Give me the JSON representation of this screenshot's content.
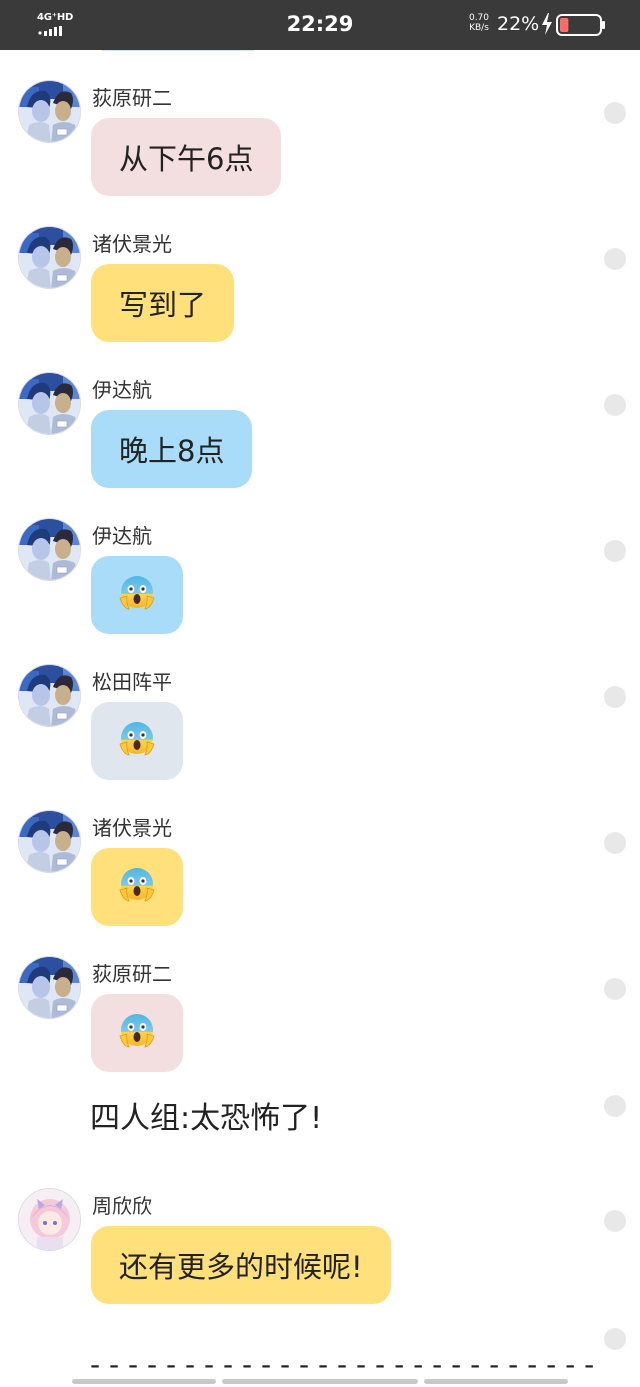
{
  "status_bar": {
    "network": "4G⁺HD",
    "time": "22:29",
    "speed_value": "0.70",
    "speed_unit": "KB/s",
    "battery_percent": "22%",
    "battery_level": 0.22
  },
  "colors": {
    "pink_bubble": "#f3dfe0",
    "yellow_bubble": "#ffe07a",
    "blue_bubble": "#a8dcf9",
    "gray_bubble": "#e0e6ee"
  },
  "messages": [
    {
      "sender": "荻原研二",
      "text": "从下午6点",
      "bubble_color": "pink",
      "avatar": "anime-avatar"
    },
    {
      "sender": "诸伏景光",
      "text": "写到了",
      "bubble_color": "yellow",
      "avatar": "anime-avatar"
    },
    {
      "sender": "伊达航",
      "text": "晚上8点",
      "bubble_color": "blue",
      "avatar": "anime-avatar"
    },
    {
      "sender": "伊达航",
      "text": "😱",
      "bubble_color": "blue",
      "avatar": "anime-avatar"
    },
    {
      "sender": "松田阵平",
      "text": "😱",
      "bubble_color": "gray",
      "avatar": "anime-avatar"
    },
    {
      "sender": "诸伏景光",
      "text": "😱",
      "bubble_color": "yellow",
      "avatar": "anime-avatar"
    },
    {
      "sender": "荻原研二",
      "text": "😱",
      "bubble_color": "pink",
      "avatar": "anime-avatar"
    }
  ],
  "narration": "四人组:太恐怖了!",
  "last_message": {
    "sender": "周欣欣",
    "text": "还有更多的时候呢!",
    "bubble_color": "yellow",
    "avatar": "anime-girl-avatar"
  },
  "divider": "- - - - - - - - - - - - - - - - - - - - - - - - - - -"
}
